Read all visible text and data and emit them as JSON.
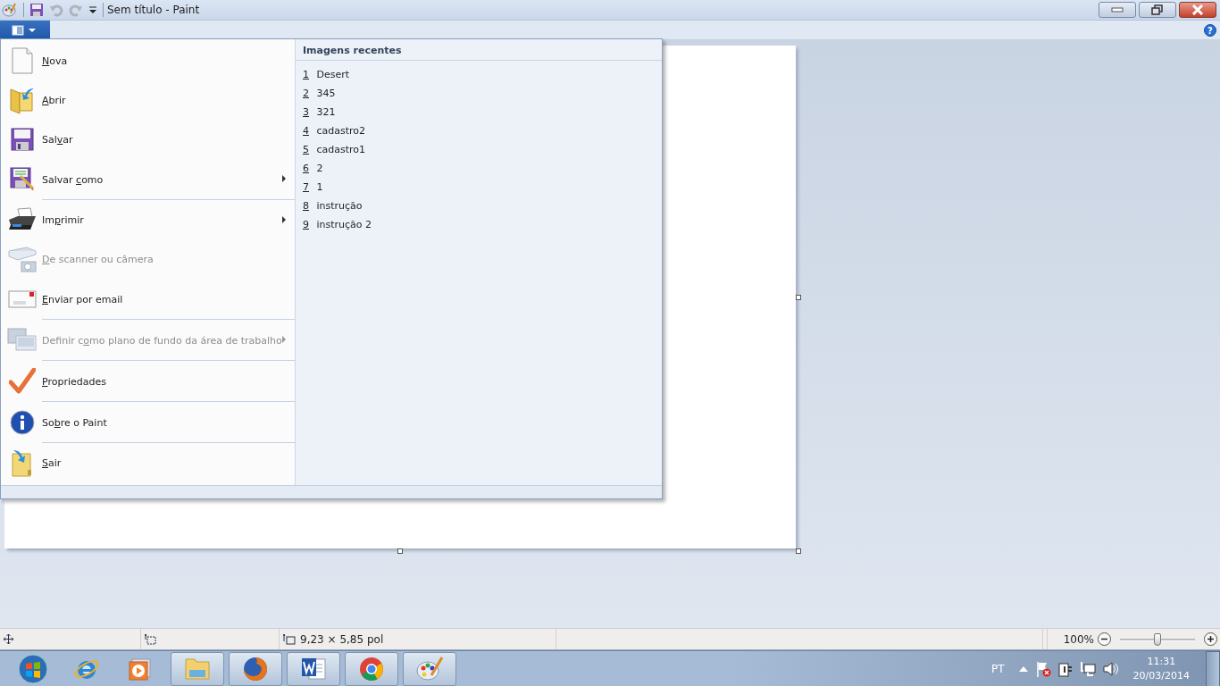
{
  "window": {
    "title": "Sem título - Paint"
  },
  "quick_access": [
    {
      "disabled": false
    },
    {
      "disabled": true
    },
    {
      "disabled": true
    },
    {
      "disabled": false
    }
  ],
  "help": "?",
  "file_menu": {
    "items": [
      {
        "key": "N",
        "after": "ova",
        "disabled": false,
        "submenu": false,
        "divider": false
      },
      {
        "key": "A",
        "after": "brir",
        "disabled": false,
        "submenu": false,
        "divider": false
      },
      {
        "before": "Sal",
        "key": "v",
        "after": "ar",
        "disabled": false,
        "submenu": false,
        "divider": false
      },
      {
        "before": "Salvar ",
        "key": "c",
        "after": "omo",
        "disabled": false,
        "submenu": true,
        "divider": true
      },
      {
        "before": "Im",
        "key": "p",
        "after": "rimir",
        "disabled": false,
        "submenu": true,
        "divider": false
      },
      {
        "key": "D",
        "after": "e scanner ou câmera",
        "disabled": true,
        "submenu": false,
        "divider": false
      },
      {
        "key": "E",
        "after": "nviar por email",
        "disabled": false,
        "submenu": false,
        "divider": true
      },
      {
        "before": "Definir c",
        "key": "o",
        "after": "mo plano de fundo da área de trabalho",
        "disabled": true,
        "submenu": true,
        "divider": true
      },
      {
        "key": "P",
        "after": "ropriedades",
        "disabled": false,
        "submenu": false,
        "divider": true
      },
      {
        "before": "So",
        "key": "b",
        "after": "re o Paint",
        "disabled": false,
        "submenu": false,
        "divider": true
      },
      {
        "key": "S",
        "after": "air",
        "disabled": false,
        "submenu": false,
        "divider": false
      }
    ],
    "recent_title": "Imagens recentes",
    "recent": [
      {
        "number": "1",
        "name": "Desert"
      },
      {
        "number": "2",
        "name": "345"
      },
      {
        "number": "3",
        "name": "321"
      },
      {
        "number": "4",
        "name": "cadastro2"
      },
      {
        "number": "5",
        "name": "cadastro1"
      },
      {
        "number": "6",
        "name": "2"
      },
      {
        "number": "7",
        "name": "1"
      },
      {
        "number": "8",
        "name": "instrução"
      },
      {
        "number": "9",
        "name": "instrução 2"
      }
    ]
  },
  "status_bar": {
    "size": "9,23 × 5,85 pol",
    "zoom": "100%",
    "level": 0.5
  },
  "taskbar": {
    "apps": [
      {
        "running": false
      },
      {
        "running": false
      },
      {
        "running": false
      },
      {
        "running": true
      },
      {
        "running": true
      },
      {
        "running": true
      },
      {
        "running": true
      },
      {
        "running": true
      }
    ],
    "language": "PT",
    "time": "11:31",
    "date": "20/03/2014"
  }
}
